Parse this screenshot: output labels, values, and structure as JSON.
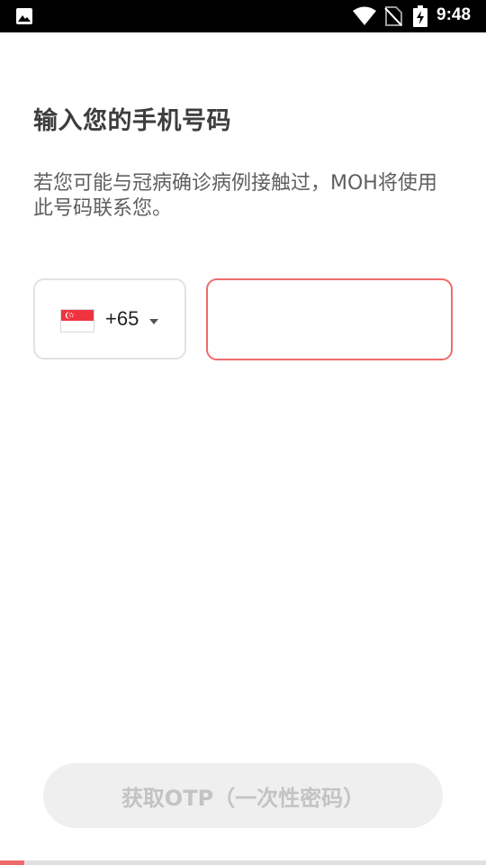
{
  "status_bar": {
    "time": "9:48",
    "icons": [
      "gallery-icon",
      "wifi-icon",
      "no-sim-icon",
      "battery-charging-icon"
    ]
  },
  "title": "输入您的手机号码",
  "description": "若您可能与冠病确诊病例接触过，MOH将使用此号码联系您。",
  "country_code": {
    "flag": "singapore-flag-icon",
    "dial_code": "+65"
  },
  "phone_input": {
    "value": "",
    "placeholder": ""
  },
  "otp_button_label": "获取OTP（一次性密码）",
  "progress": {
    "fraction": 0.05
  },
  "colors": {
    "accent": "#ee6a6a",
    "status_bar": "#000000",
    "disabled_button_bg": "#efefef",
    "disabled_button_text": "#c3c3c3"
  }
}
